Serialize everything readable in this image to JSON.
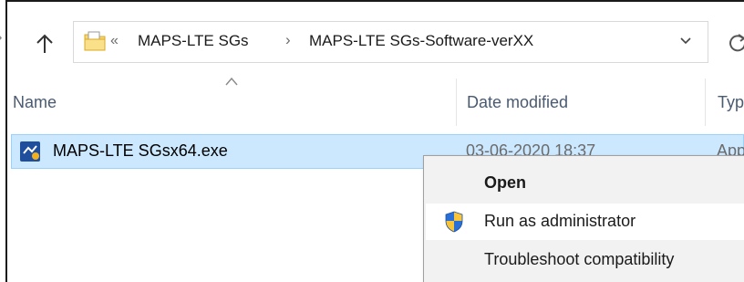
{
  "address_bar": {
    "overflow_indicator": "«",
    "crumbs": [
      "MAPS-LTE SGs",
      "MAPS-LTE SGs-Software-verXX"
    ],
    "separator": "›"
  },
  "columns": {
    "name": "Name",
    "date_modified": "Date modified",
    "type": "Typ"
  },
  "file": {
    "name": "MAPS-LTE SGsx64.exe",
    "date_modified": "03-06-2020 18:37",
    "type": "App"
  },
  "context_menu": {
    "items": [
      {
        "label": "Open",
        "bold": true
      },
      {
        "label": "Run as administrator",
        "icon": "uac-shield-icon"
      },
      {
        "label": "Troubleshoot compatibility"
      }
    ]
  },
  "colors": {
    "selection_bg": "#cce8ff",
    "selection_border": "#99d1ff",
    "menu_bg": "#f2f2f2",
    "header_text": "#4a5a70"
  }
}
